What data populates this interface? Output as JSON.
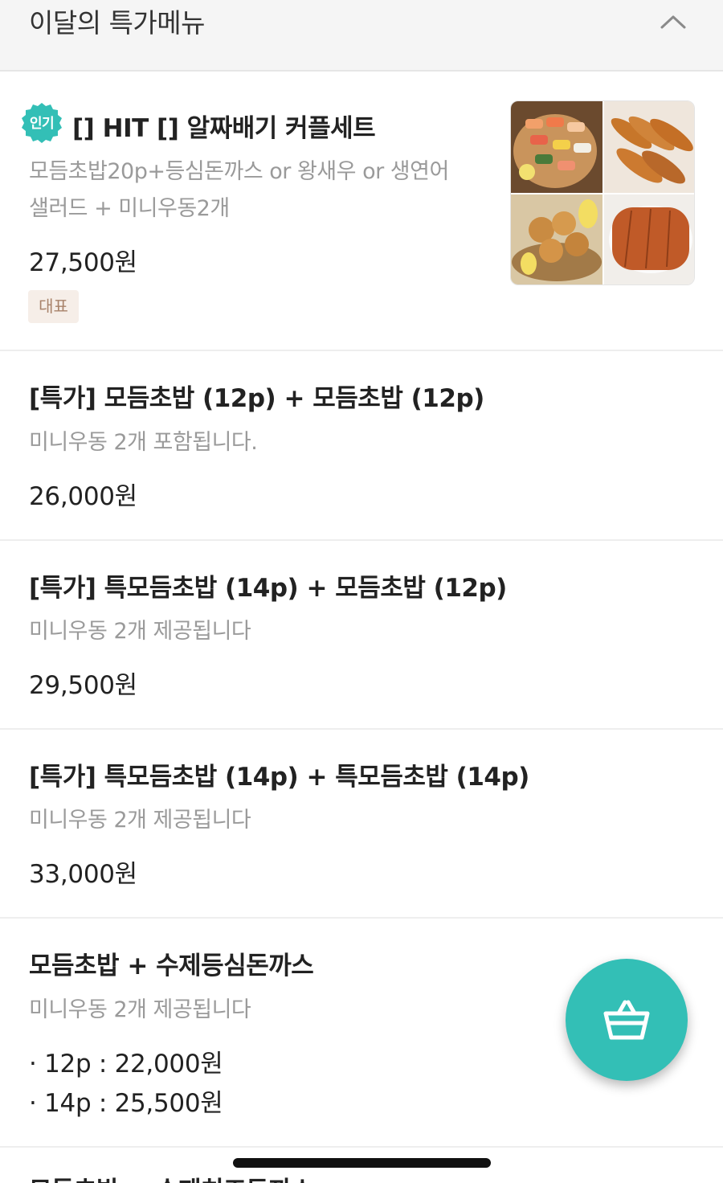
{
  "section": {
    "title": "이달의 특가메뉴"
  },
  "items": [
    {
      "badge": "인기",
      "title": "[] HIT [] 알짜배기 커플세트",
      "desc_line1": "모듬초밥20p+등심돈까스 or 왕새우 or 생연어",
      "desc_line2": "샐러드 + 미니우동2개",
      "price": "27,500원",
      "tag": "대표"
    },
    {
      "title": "[특가] 모듬초밥 (12p) + 모듬초밥 (12p)",
      "desc": "미니우동 2개 포함됩니다.",
      "price": "26,000원"
    },
    {
      "title": "[특가] 특모듬초밥 (14p) + 모듬초밥 (12p)",
      "desc": "미니우동 2개 제공됩니다",
      "price": "29,500원"
    },
    {
      "title": "[특가] 특모듬초밥 (14p) + 특모듬초밥 (14p)",
      "desc": "미니우동 2개 제공됩니다",
      "price": "33,000원"
    },
    {
      "title": "모듬초밥 + 수제등심돈까스",
      "desc": "미니우동 2개 제공됩니다",
      "price_options": [
        "· 12p : 22,000원",
        "· 14p : 25,500원"
      ]
    }
  ],
  "next_item_peek": "모듬초밥 + 수제치즈돈까스",
  "colors": {
    "accent": "#33bfb6",
    "tag_bg": "#f6eee8",
    "tag_text": "#a8826a",
    "desc_text": "#9a9a9a"
  },
  "icons": {
    "collapse": "chevron-up-icon",
    "cart": "basket-icon",
    "badge": "popular-badge-icon"
  }
}
